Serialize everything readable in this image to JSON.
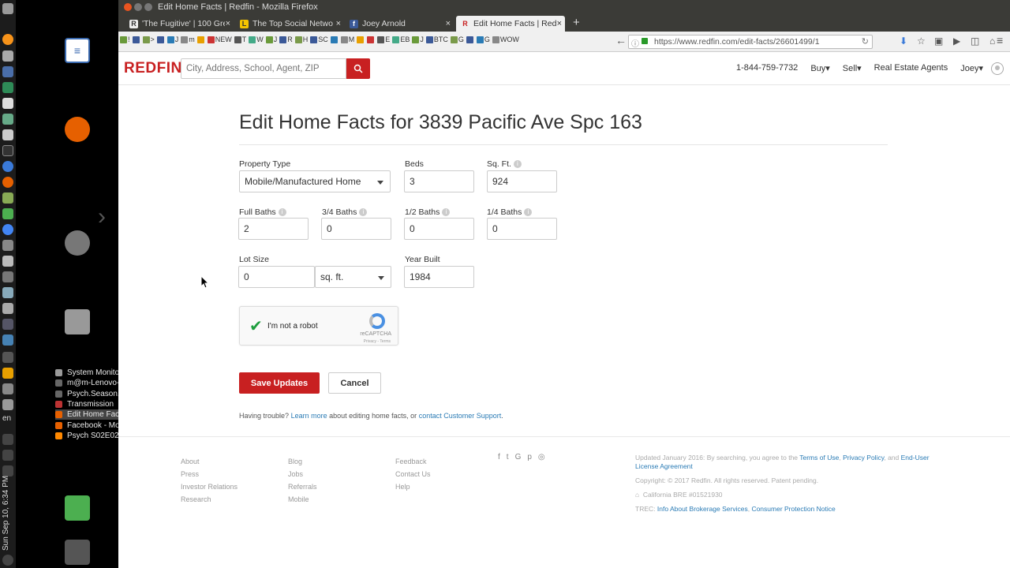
{
  "desktop": {
    "clock": "Sun Sep 10, 6:34 PM",
    "lang": "en",
    "taskbar": [
      {
        "label": "System Monitor",
        "color": "#999"
      },
      {
        "label": "m@m-Lenovo-...",
        "color": "#666"
      },
      {
        "label": "Psych.Season....",
        "color": "#666"
      },
      {
        "label": "Transmission",
        "color": "#b33"
      },
      {
        "label": "Edit Home Fact...",
        "color": "#e66000"
      },
      {
        "label": "Facebook - Mo...",
        "color": "#e66000"
      },
      {
        "label": "Psych S02E02 - ...",
        "color": "#f80"
      }
    ]
  },
  "browser": {
    "window_title": "Edit Home Facts | Redfin - Mozilla Firefox",
    "tabs": [
      {
        "label": "'The Fugitive' | 100 Gre",
        "favicon": "R",
        "favcolor": "#333",
        "favbg": "#eee"
      },
      {
        "label": "The Top Social Netwo",
        "favicon": "L",
        "favcolor": "#333",
        "favbg": "#f5c400"
      },
      {
        "label": "Joey Arnold",
        "favicon": "f",
        "favcolor": "#fff",
        "favbg": "#3b5998"
      },
      {
        "label": "Edit Home Facts | Redf",
        "favicon": "R",
        "favcolor": "#c82021",
        "favbg": "#f0f0f0"
      }
    ],
    "url": "https://www.redfin.com/edit-facts/26601499/1",
    "bookmarks": [
      "!",
      "",
      ">",
      "",
      "J",
      "m",
      "",
      "NEW",
      "T",
      "W",
      "J",
      "R",
      "H",
      "SC",
      "",
      "M",
      "",
      "",
      "E",
      "EB",
      "J",
      "BTC",
      "G",
      "",
      "G",
      "WOW"
    ]
  },
  "redfin": {
    "logo": "REDFIN",
    "search_placeholder": "City, Address, School, Agent, ZIP",
    "phone": "1-844-759-7732",
    "nav_buy": "Buy▾",
    "nav_sell": "Sell▾",
    "nav_agents": "Real Estate Agents",
    "nav_user": "Joey▾"
  },
  "form": {
    "title": "Edit Home Facts for 3839 Pacific Ave Spc 163",
    "property_type_label": "Property Type",
    "property_type_value": "Mobile/Manufactured Home",
    "beds_label": "Beds",
    "beds_value": "3",
    "sqft_label": "Sq. Ft.",
    "sqft_value": "924",
    "full_baths_label": "Full Baths",
    "full_baths_value": "2",
    "three_quarter_baths_label": "3/4 Baths",
    "three_quarter_baths_value": "0",
    "half_baths_label": "1/2 Baths",
    "half_baths_value": "0",
    "quarter_baths_label": "1/4 Baths",
    "quarter_baths_value": "0",
    "lot_size_label": "Lot Size",
    "lot_size_value": "0",
    "lot_unit_value": "sq. ft.",
    "year_built_label": "Year Built",
    "year_built_value": "1984",
    "captcha_text": "I'm not a robot",
    "captcha_brand": "reCAPTCHA",
    "captcha_terms": "Privacy - Terms",
    "save_label": "Save Updates",
    "cancel_label": "Cancel",
    "trouble_prefix": "Having trouble?",
    "trouble_learn": "Learn more",
    "trouble_middle": "about editing home facts, or",
    "trouble_support": "contact Customer Support",
    "trouble_suffix": "."
  },
  "footer": {
    "col1": [
      "About",
      "Press",
      "Investor Relations",
      "Research"
    ],
    "col2": [
      "Blog",
      "Jobs",
      "Referrals",
      "Mobile"
    ],
    "col3": [
      "Feedback",
      "Contact Us",
      "Help"
    ],
    "legal_prefix": "Updated January 2016: By searching, you agree to the",
    "legal_terms": "Terms of Use",
    "legal_privacy": "Privacy Policy",
    "legal_and": ", and",
    "legal_eula": "End-User License Agreement",
    "copyright": "Copyright: © 2017 Redfin. All rights reserved. Patent pending.",
    "bre": "California BRE #01521930",
    "trec_prefix": "TREC:",
    "trec_info": "Info About Brokerage Services",
    "trec_notice": "Consumer Protection Notice"
  }
}
